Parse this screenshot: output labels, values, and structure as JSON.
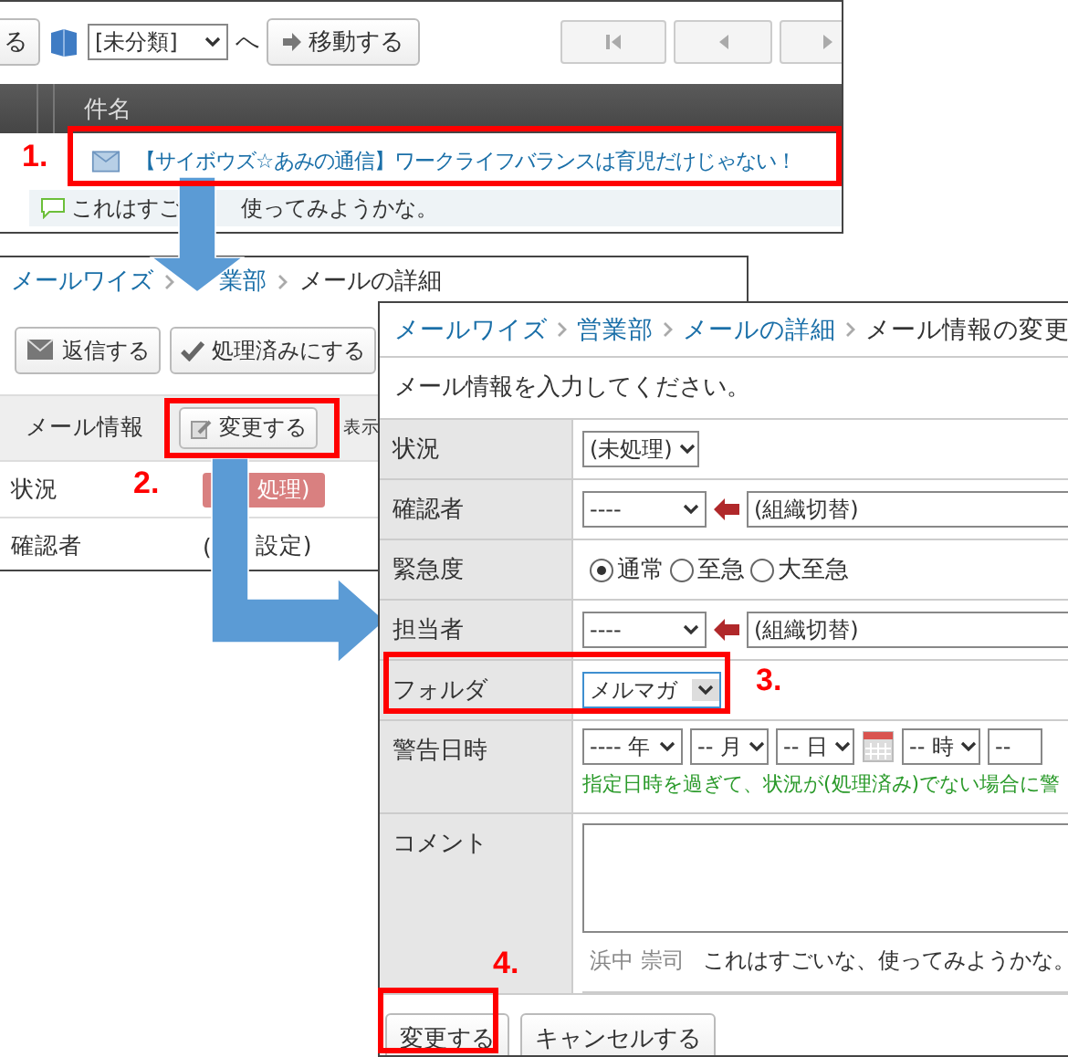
{
  "list_window": {
    "toolbar": {
      "cut_button": "る",
      "folder_select": "[未分類]",
      "suffix": "へ",
      "move_button": "移動する"
    },
    "column_header": "件名",
    "step": "1.",
    "message": {
      "subject": "【サイボウズ☆あみの通信】ワークライフバランスは育児だけじゃない！",
      "comment_parts": [
        "これはすご",
        "使ってみようかな。"
      ]
    }
  },
  "detail_window": {
    "breadcrumb": [
      {
        "label": "メールワイズ",
        "link": true
      },
      {
        "label": "業部",
        "link": true
      },
      {
        "label": "メールの詳細",
        "link": false
      }
    ],
    "buttons": [
      {
        "label": "返信する",
        "kind": "reply"
      },
      {
        "label": "処理済みにする",
        "kind": "done"
      }
    ],
    "info_bar": {
      "title": "メール情報",
      "edit_button": "変更する",
      "cut_label": "表示"
    },
    "step": "2.",
    "rows": [
      {
        "label": "状況",
        "kind": "badge",
        "values": [
          "処理)"
        ]
      },
      {
        "label": "確認者",
        "kind": "text",
        "values": [
          "(",
          "設定)"
        ]
      }
    ]
  },
  "edit_window": {
    "breadcrumb": [
      {
        "label": "メールワイズ",
        "link": true
      },
      {
        "label": "営業部",
        "link": true
      },
      {
        "label": "メールの詳細",
        "link": true
      },
      {
        "label": "メール情報の変更",
        "link": false
      }
    ],
    "instruction": "メール情報を入力してください。",
    "fields": [
      {
        "label": "状況",
        "kind": "select",
        "value": "(未処理)"
      },
      {
        "label": "確認者",
        "kind": "picker",
        "value": "----",
        "group": "(組織切替)"
      },
      {
        "label": "緊急度",
        "kind": "radio",
        "options": [
          {
            "label": "通常",
            "selected": true
          },
          {
            "label": "至急",
            "selected": false
          },
          {
            "label": "大至急",
            "selected": false
          }
        ]
      },
      {
        "label": "担当者",
        "kind": "picker",
        "value": "----",
        "group": "(組織切替)"
      },
      {
        "label": "フォルダ",
        "kind": "folder",
        "value": "メルマガ"
      },
      {
        "label": "警告日時",
        "kind": "date",
        "parts": [
          "---- 年",
          "-- 月",
          "-- 日",
          "-- 時",
          "--"
        ],
        "note": "指定日時を過ぎて、状況が(処理済み)でない場合に警"
      },
      {
        "label": "コメント",
        "kind": "comment",
        "author": "浜中 崇司",
        "text": "これはすごいな、使ってみようかな。"
      }
    ],
    "steps": [
      "3.",
      "4."
    ],
    "buttons": [
      "変更する",
      "キャンセルする"
    ]
  }
}
